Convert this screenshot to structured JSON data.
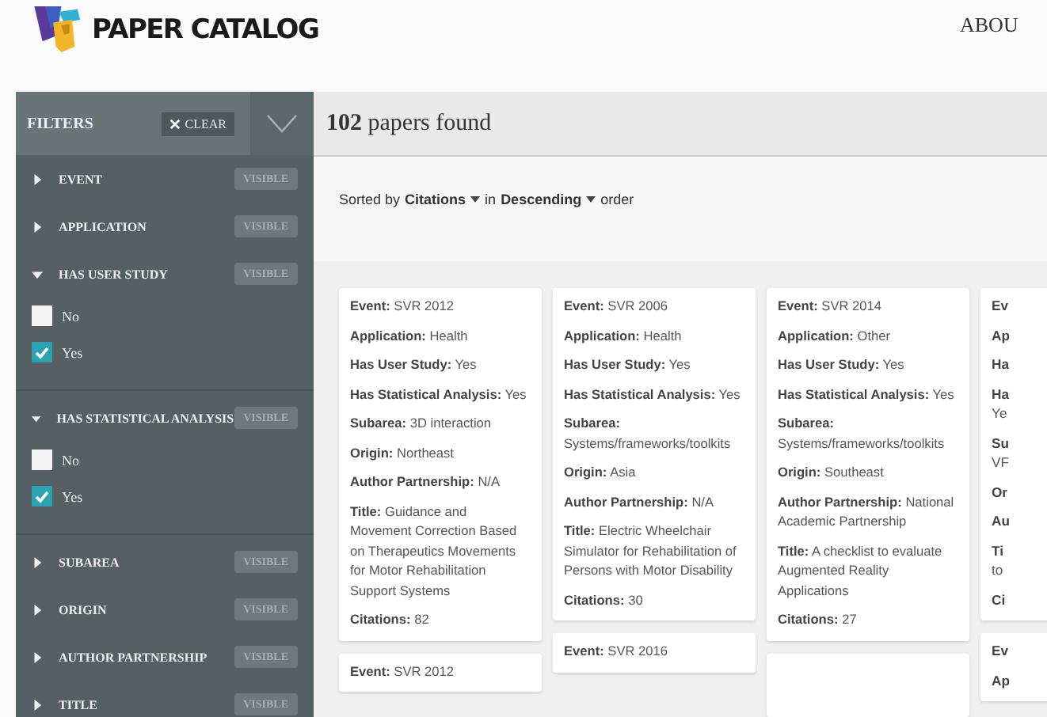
{
  "header": {
    "title": "PAPER CATALOG",
    "nav": [
      "ABOU"
    ]
  },
  "filters": {
    "title": "FILTERS",
    "clear": "CLEAR",
    "groups": [
      {
        "label": "EVENT",
        "expanded": false,
        "badge": "VISIBLE"
      },
      {
        "label": "APPLICATION",
        "expanded": false,
        "badge": "VISIBLE"
      },
      {
        "label": "HAS USER STUDY",
        "expanded": true,
        "badge": "VISIBLE",
        "options": [
          {
            "label": "No",
            "checked": false
          },
          {
            "label": "Yes",
            "checked": true
          }
        ]
      },
      {
        "label": "HAS STATISTICAL ANALYSIS",
        "expanded": true,
        "badge": "VISIBLE",
        "options": [
          {
            "label": "No",
            "checked": false
          },
          {
            "label": "Yes",
            "checked": true
          }
        ]
      },
      {
        "label": "SUBAREA",
        "expanded": false,
        "badge": "VISIBLE"
      },
      {
        "label": "ORIGIN",
        "expanded": false,
        "badge": "VISIBLE"
      },
      {
        "label": "AUTHOR PARTNERSHIP",
        "expanded": false,
        "badge": "VISIBLE"
      },
      {
        "label": "TITLE",
        "expanded": false,
        "badge": "VISIBLE"
      }
    ]
  },
  "results": {
    "count": "102",
    "count_label": "papers found"
  },
  "sort": {
    "prefix": "Sorted by",
    "field": "Citations",
    "middle": "in",
    "order": "Descending",
    "suffix": "order"
  },
  "columns": [
    {
      "cards": [
        {
          "kind": "full",
          "fields": [
            {
              "label": "Event:",
              "value": "SVR 2012"
            },
            {
              "label": "Application:",
              "value": "Health"
            },
            {
              "label": "Has User Study:",
              "value": "Yes"
            },
            {
              "label": "Has Statistical Analysis:",
              "value": "Yes"
            },
            {
              "label": "Subarea:",
              "value": "3D interaction"
            },
            {
              "label": "Origin:",
              "value": "Northeast"
            },
            {
              "label": "Author Partnership:",
              "value": "N/A"
            },
            {
              "label": "Title:",
              "value": "Guidance and Movement Correction Based on Therapeutics Movements for Motor Rehabilitation Support Systems"
            },
            {
              "label": "Citations:",
              "value": "82"
            }
          ]
        },
        {
          "kind": "full",
          "fields": [
            {
              "label": "Event:",
              "value": "SVR 2012"
            }
          ]
        }
      ]
    },
    {
      "cards": [
        {
          "kind": "full",
          "fields": [
            {
              "label": "Event:",
              "value": "SVR 2006"
            },
            {
              "label": "Application:",
              "value": "Health"
            },
            {
              "label": "Has User Study:",
              "value": "Yes"
            },
            {
              "label": "Has Statistical Analysis:",
              "value": "Yes"
            },
            {
              "label": "Subarea:",
              "value": "Systems/frameworks/toolkits"
            },
            {
              "label": "Origin:",
              "value": "Asia"
            },
            {
              "label": "Author Partnership:",
              "value": "N/A"
            },
            {
              "label": "Title:",
              "value": "Electric Wheelchair Simulator for Rehabilitation of Persons with Motor Disability"
            },
            {
              "label": "Citations:",
              "value": "30"
            }
          ]
        },
        {
          "kind": "full",
          "fields": [
            {
              "label": "Event:",
              "value": "SVR 2016"
            }
          ]
        }
      ]
    },
    {
      "cards": [
        {
          "kind": "full",
          "fields": [
            {
              "label": "Event:",
              "value": "SVR 2014"
            },
            {
              "label": "Application:",
              "value": "Other"
            },
            {
              "label": "Has User Study:",
              "value": "Yes"
            },
            {
              "label": "Has Statistical Analysis:",
              "value": "Yes"
            },
            {
              "label": "Subarea:",
              "value": "Systems/frameworks/toolkits"
            },
            {
              "label": "Origin:",
              "value": "Southeast"
            },
            {
              "label": "Author Partnership:",
              "value": "National Academic Partnership"
            },
            {
              "label": "Title:",
              "value": "A checklist to evaluate Augmented Reality Applications"
            },
            {
              "label": "Citations:",
              "value": "27"
            }
          ]
        },
        {
          "kind": "empty"
        }
      ]
    },
    {
      "cards": [
        {
          "kind": "clipped",
          "fields": [
            {
              "label": "Ev"
            },
            {
              "label": "Ap"
            },
            {
              "label": "Ha"
            },
            {
              "label": "Ha",
              "value": "Ye"
            },
            {
              "label": "Su",
              "value": "VF"
            },
            {
              "label": "Or"
            },
            {
              "label": "Au"
            },
            {
              "label": "Ti",
              "value": "to"
            },
            {
              "label": "Ci"
            }
          ]
        },
        {
          "kind": "clipped",
          "fields": [
            {
              "label": "Ev"
            },
            {
              "label": "Ap"
            }
          ]
        }
      ]
    }
  ]
}
